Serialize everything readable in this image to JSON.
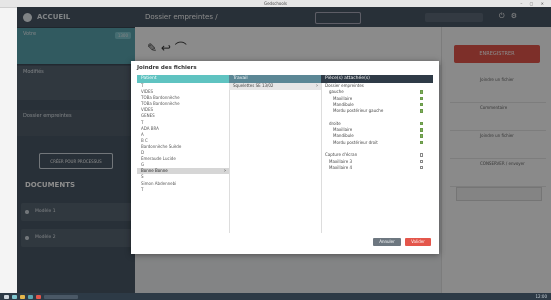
{
  "window": {
    "title": "Gedschools",
    "controls": "–  ▢  ✕"
  },
  "sidebar": {
    "brand": "ACCUEIL",
    "active_item": {
      "label": "Votre",
      "badge": "1300"
    },
    "block_item": "Modifiés",
    "mid_item": "Dossier empreintes",
    "import_button": "CRÉER POUR PROCESSUS",
    "documents_heading": "DOCUMENTS",
    "documents": [
      "Modèle 1",
      "Modèle 2"
    ]
  },
  "main": {
    "title": "Dossier empreintes / ",
    "toolbar_signature": "✎ ↩ ⌒"
  },
  "right_panel": {
    "cta": "ENREGISTRER",
    "rows": [
      "Joindre un fichier",
      "Commentaire",
      "Joindre un fichier",
      "CONSERVER / envoyer"
    ]
  },
  "modal": {
    "title": "Joindre des fichiers",
    "col_headers": [
      "Patient",
      "Travail",
      "Pièce(s) attachée(s)"
    ],
    "patients": [
      "T",
      "VIDES",
      "TOBa Bardonnèche",
      "TOBa Bardonnèche",
      "VIDES",
      "GENES",
      "T",
      "ADA BRA",
      "A",
      "B C",
      "Bardonnèche Suède",
      "D",
      "Émeraude Lucide",
      "G",
      "Bonne Bonne",
      "S",
      "Simon Abdennebi",
      "T"
    ],
    "selected_patient": "Bonne Bonne",
    "travail": [
      "Squelettes SE 13/02"
    ],
    "attachments": [
      {
        "label": "Dossier empreintes",
        "checked": false
      },
      {
        "label": "gauche",
        "checked": true
      },
      {
        "label": "Maxillaire",
        "checked": true
      },
      {
        "label": "Mandibule",
        "checked": true
      },
      {
        "label": "Mordu postérieur gauche",
        "checked": true
      },
      {
        "label": "",
        "checked": false
      },
      {
        "label": "droite",
        "checked": true
      },
      {
        "label": "Maxillaire",
        "checked": true
      },
      {
        "label": "Mandibule",
        "checked": true
      },
      {
        "label": "Mordu postérieur droit",
        "checked": true
      },
      {
        "label": "",
        "checked": false
      },
      {
        "label": "Capture d'écran",
        "checked": false
      },
      {
        "label": "Maxillaire 3",
        "checked": false
      },
      {
        "label": "Maxillaire 4",
        "checked": false
      }
    ],
    "cancel": "Annuler",
    "validate": "Valider"
  },
  "taskbar": {
    "clock": "12:00"
  }
}
